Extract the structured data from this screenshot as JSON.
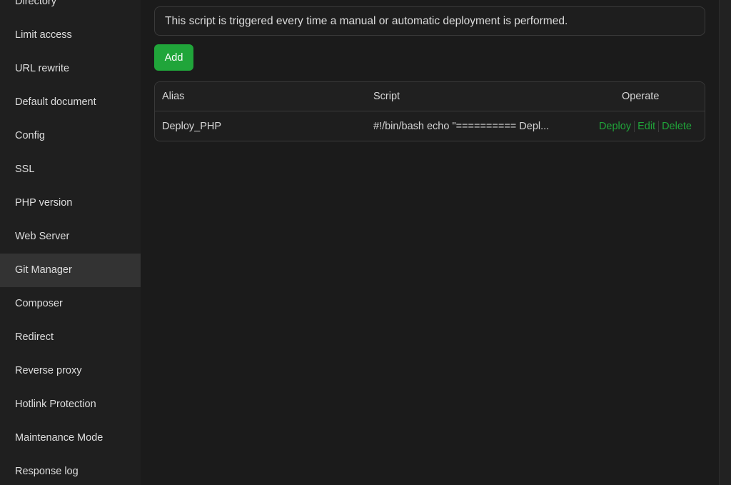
{
  "sidebar": {
    "items": [
      {
        "label": "Directory"
      },
      {
        "label": "Limit access"
      },
      {
        "label": "URL rewrite"
      },
      {
        "label": "Default document"
      },
      {
        "label": "Config"
      },
      {
        "label": "SSL"
      },
      {
        "label": "PHP version"
      },
      {
        "label": "Web Server"
      },
      {
        "label": "Git Manager",
        "active": true
      },
      {
        "label": "Composer"
      },
      {
        "label": "Redirect"
      },
      {
        "label": "Reverse proxy"
      },
      {
        "label": "Hotlink Protection"
      },
      {
        "label": "Maintenance Mode"
      },
      {
        "label": "Response log"
      }
    ]
  },
  "main": {
    "notice": "This script is triggered every time a manual or automatic deployment is performed.",
    "add_label": "Add",
    "table": {
      "headers": {
        "alias": "Alias",
        "script": "Script",
        "operate": "Operate"
      },
      "rows": [
        {
          "alias": "Deploy_PHP",
          "script": "#!/bin/bash echo \"========== Depl...",
          "deploy": "Deploy",
          "edit": "Edit",
          "delete": "Delete"
        }
      ]
    }
  },
  "colors": {
    "accent": "#20a53a",
    "background": "#1b1b1b",
    "sidebar_bg": "#1f1f1f",
    "sidebar_active": "#333333"
  }
}
